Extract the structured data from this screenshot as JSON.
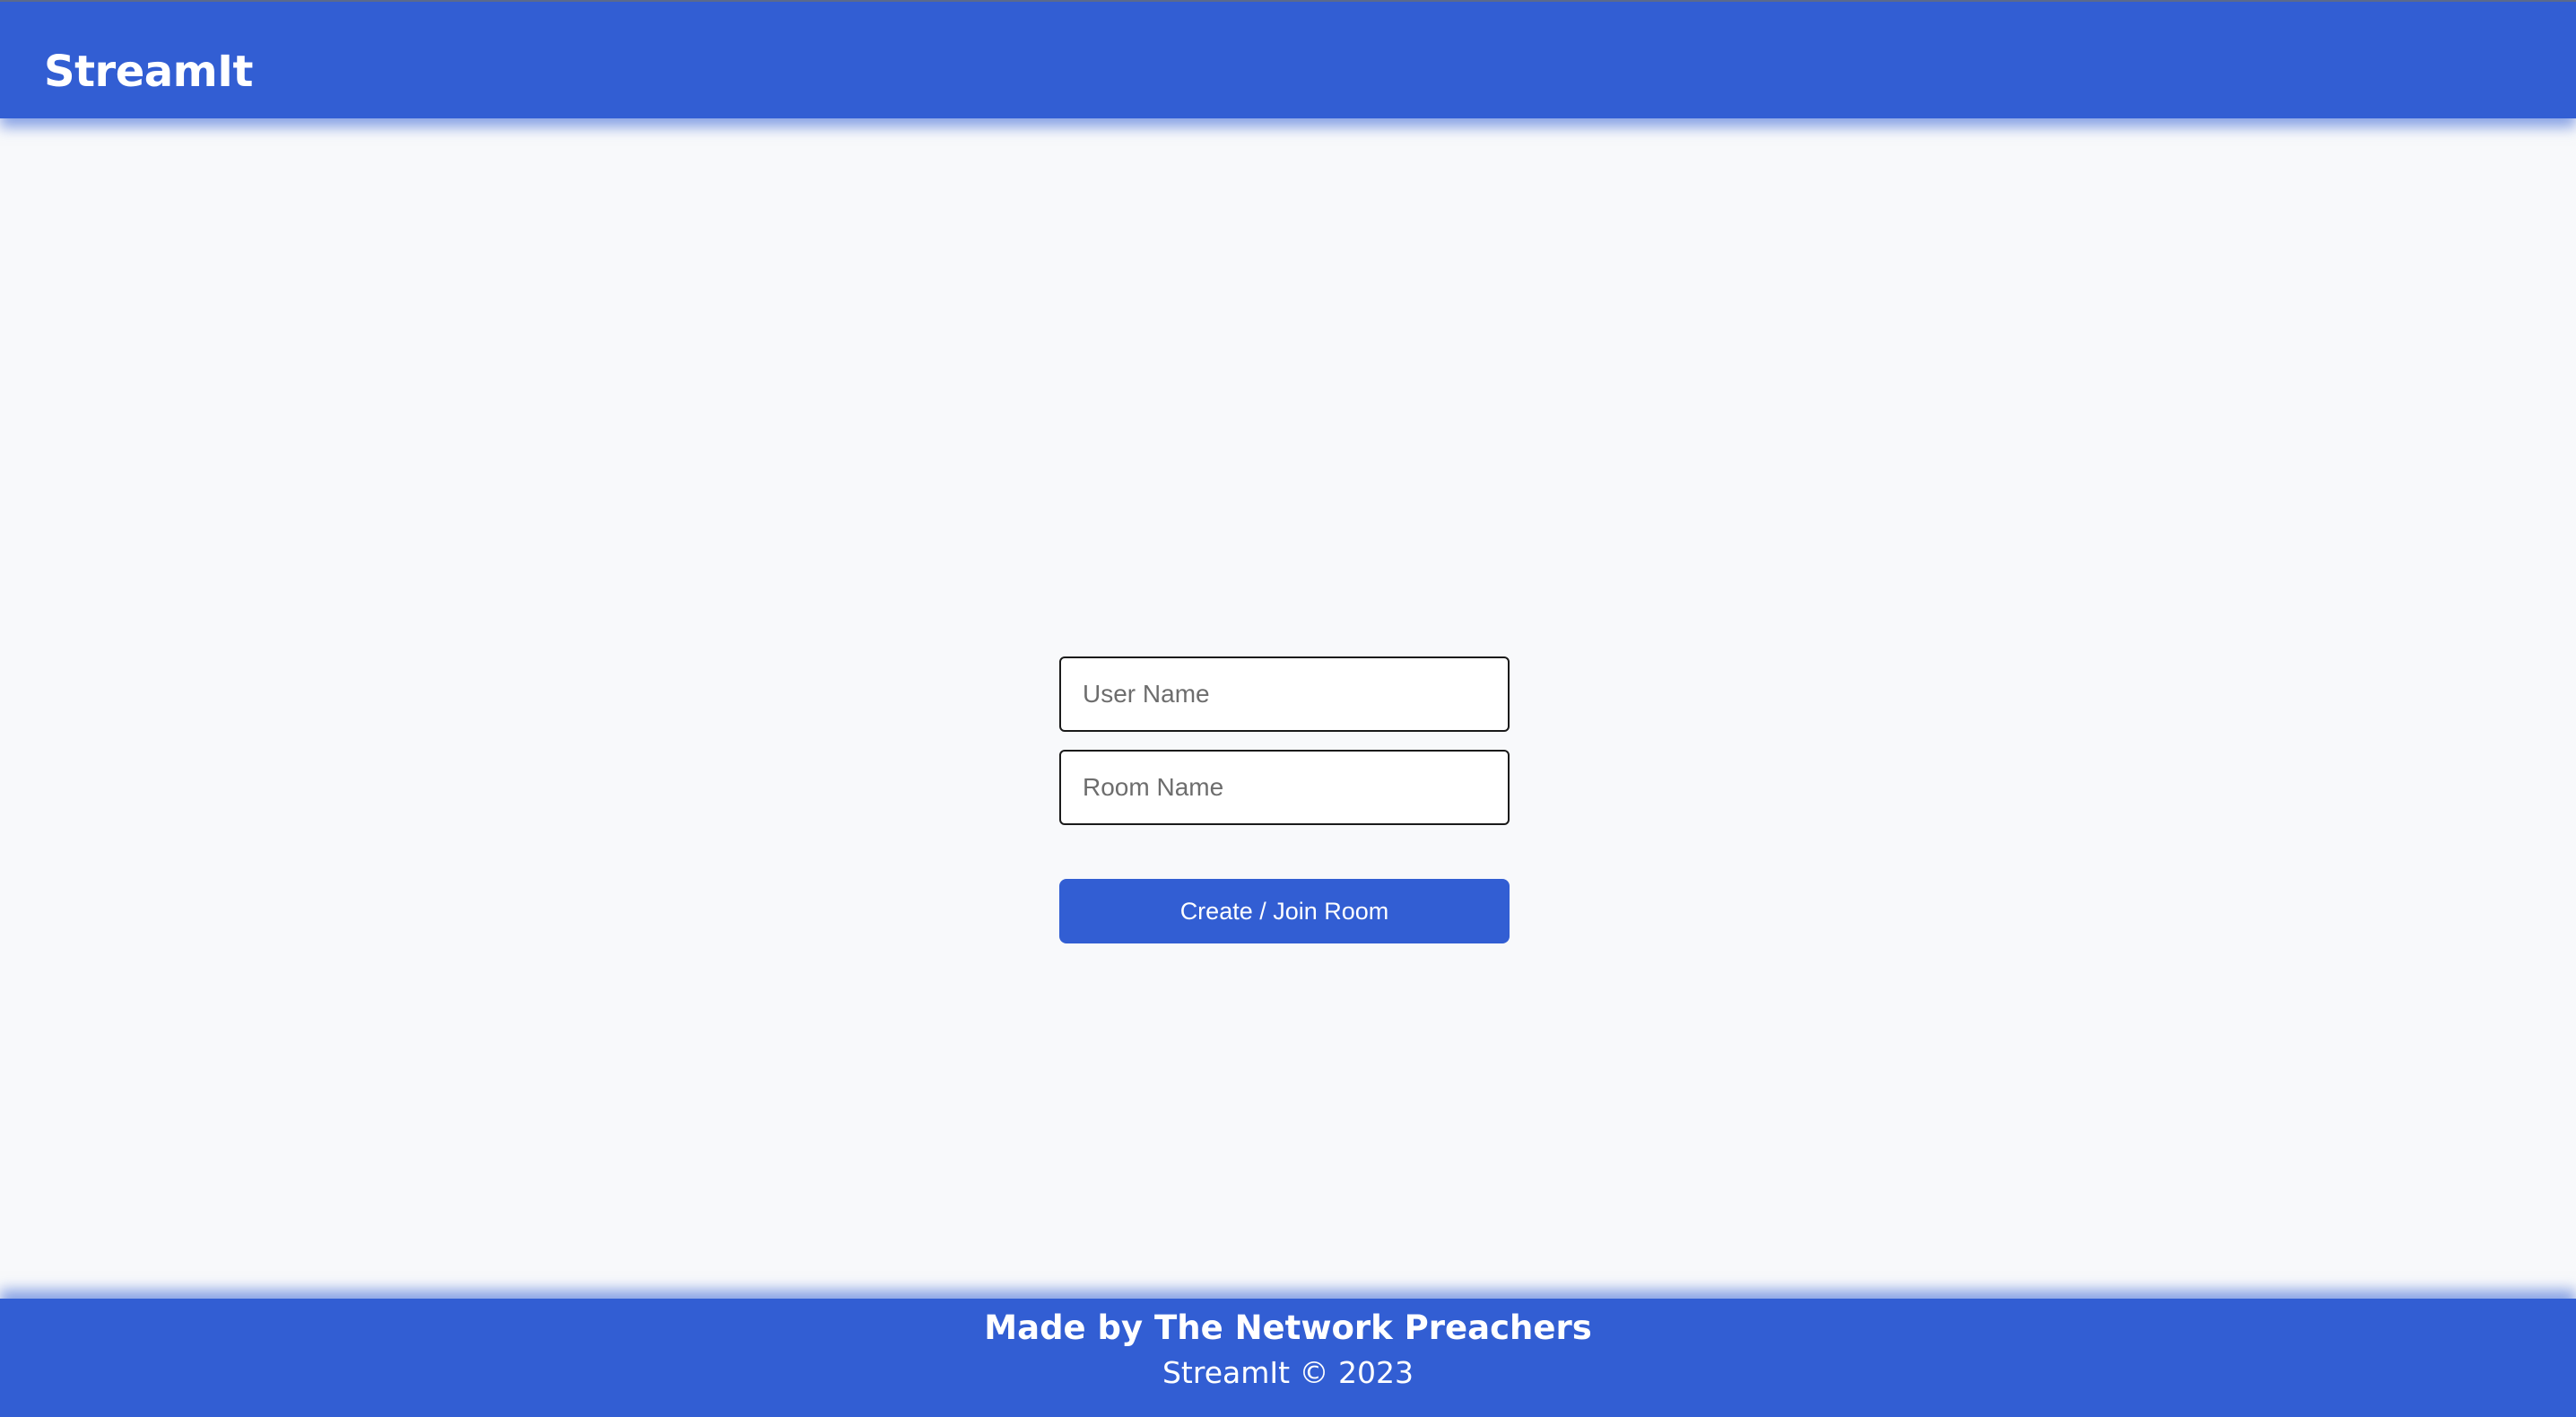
{
  "header": {
    "brand": "StreamIt"
  },
  "form": {
    "user_name": {
      "placeholder": "User Name",
      "value": ""
    },
    "room_name": {
      "placeholder": "Room Name",
      "value": ""
    },
    "submit_label": "Create / Join Room"
  },
  "footer": {
    "credit": "Made by The Network Preachers",
    "copyright": "StreamIt © 2023"
  },
  "colors": {
    "brand_blue": "#325ed3",
    "page_background": "#f8f9fb",
    "text_on_brand": "#ffffff"
  }
}
